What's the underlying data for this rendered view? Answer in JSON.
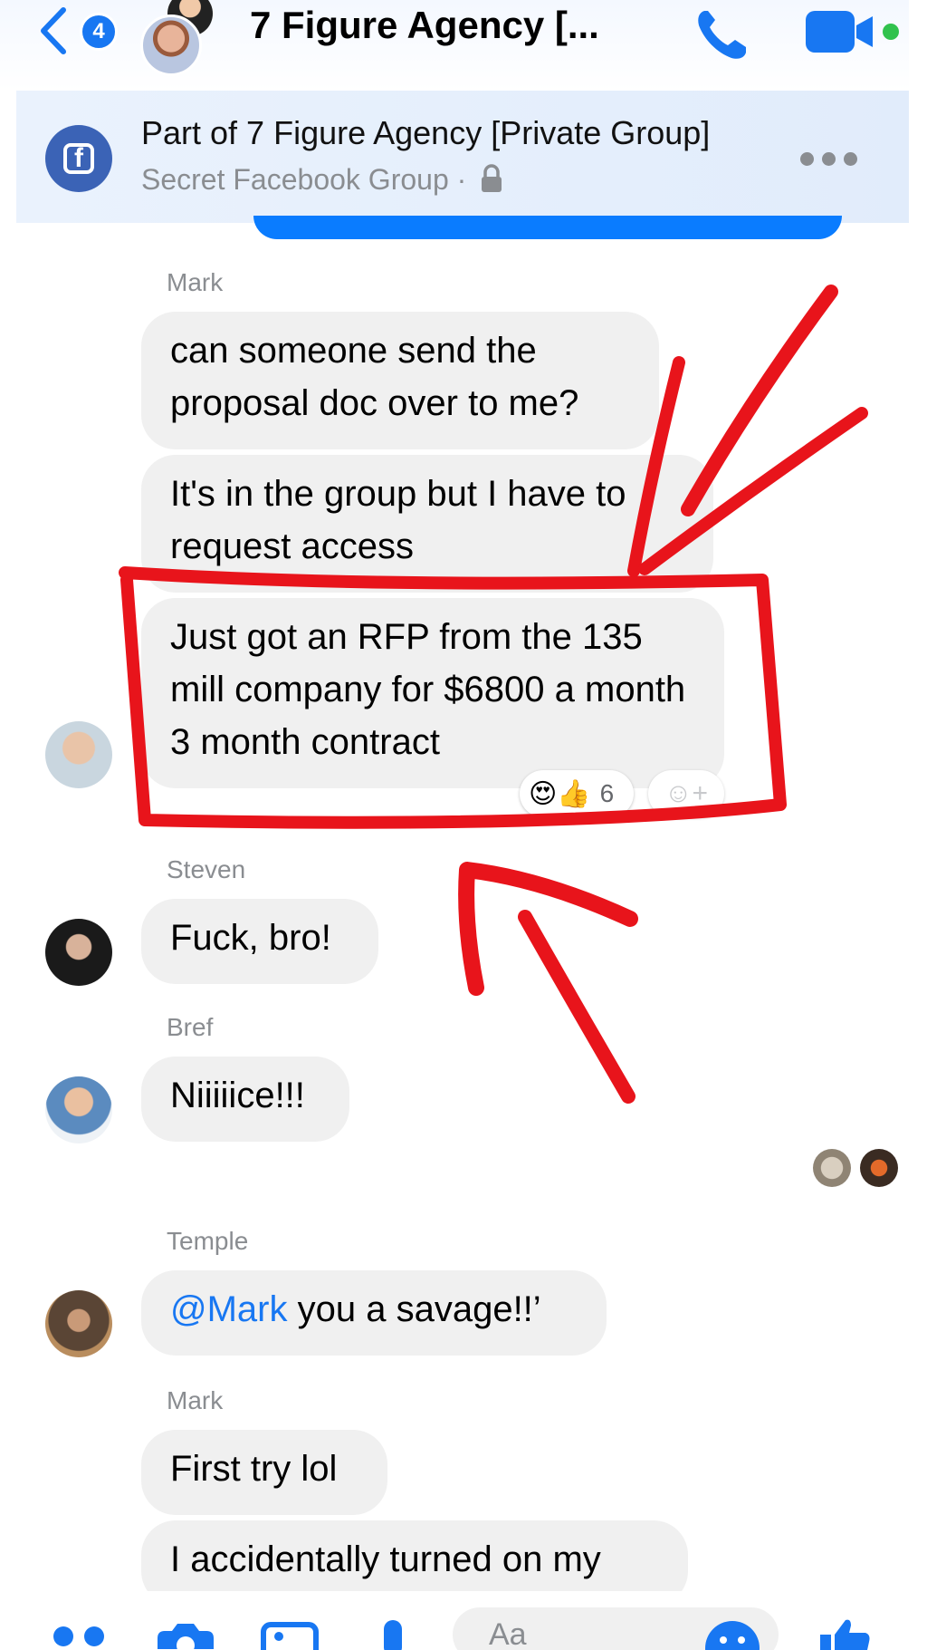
{
  "header": {
    "unread_count": "4",
    "title": "7 Figure Agency [..."
  },
  "banner": {
    "title": "Part of 7 Figure Agency [Private Group]",
    "subtitle": "Secret Facebook Group ·"
  },
  "messages": [
    {
      "sender": "Mark",
      "bubbles": [
        "can someone send the proposal doc over to me?",
        "It's in the group but I have to request access",
        "Just got an RFP from the 135 mill company for $6800 a month 3 month contract"
      ],
      "reaction_count": "6"
    },
    {
      "sender": "Steven",
      "bubbles": [
        "Fuck, bro!"
      ]
    },
    {
      "sender": "Bref",
      "bubbles": [
        "Niiiiice!!!"
      ]
    },
    {
      "sender": "Temple",
      "mention": "@Mark",
      "text": " you a savage!!’"
    },
    {
      "sender": "Mark",
      "bubbles": [
        "First try lol",
        "I accidentally turned on my"
      ]
    }
  ],
  "composer": {
    "placeholder": "Aa"
  },
  "colors": {
    "accent": "#1877f2",
    "annotation": "#e8141b",
    "bubble": "#f0f0f0"
  }
}
